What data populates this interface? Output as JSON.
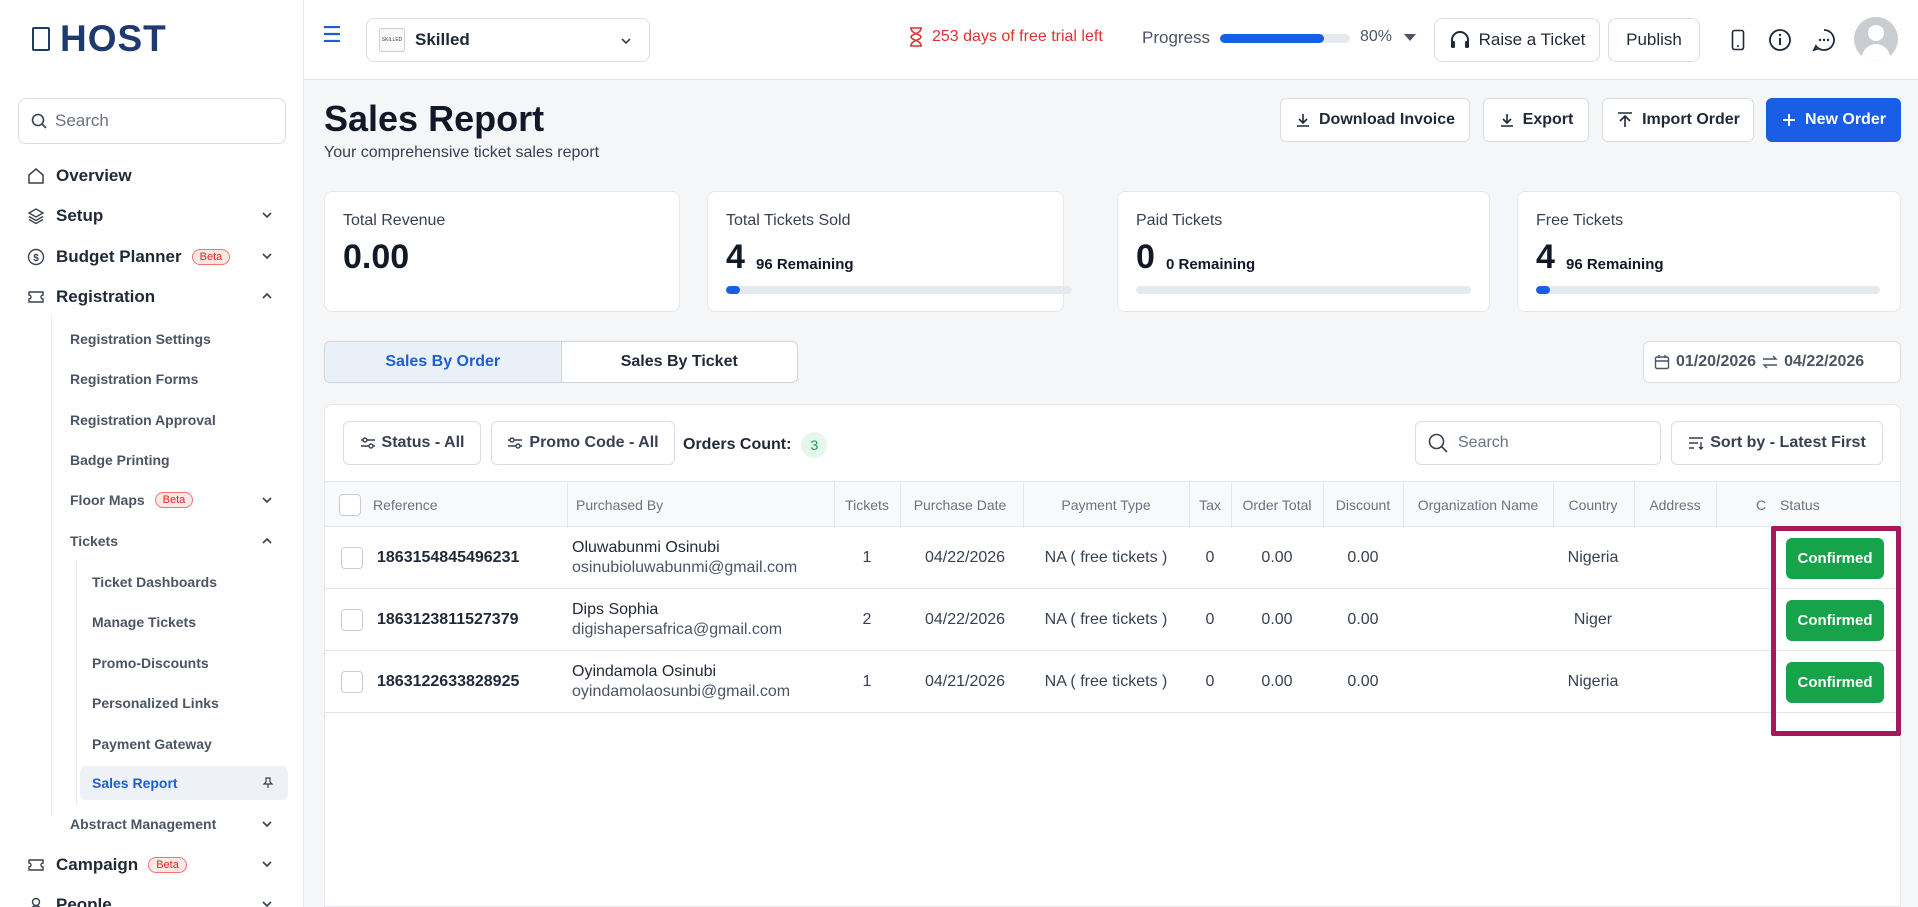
{
  "brand": {
    "name": "HOST"
  },
  "sidebar": {
    "search_placeholder": "Search",
    "items": [
      {
        "label": "Overview"
      },
      {
        "label": "Setup"
      },
      {
        "label": "Budget Planner",
        "badge": "Beta"
      },
      {
        "label": "Registration"
      },
      {
        "label": "Campaign",
        "badge": "Beta"
      },
      {
        "label": "People"
      }
    ],
    "registration_sub": [
      {
        "label": "Registration Settings"
      },
      {
        "label": "Registration Forms"
      },
      {
        "label": "Registration Approval"
      },
      {
        "label": "Badge Printing"
      },
      {
        "label": "Floor Maps",
        "badge": "Beta"
      },
      {
        "label": "Tickets"
      },
      {
        "label": "Abstract Management"
      }
    ],
    "tickets_sub": [
      {
        "label": "Ticket Dashboards"
      },
      {
        "label": "Manage Tickets"
      },
      {
        "label": "Promo-Discounts"
      },
      {
        "label": "Personalized Links"
      },
      {
        "label": "Payment Gateway"
      },
      {
        "label": "Sales Report"
      }
    ]
  },
  "topbar": {
    "event_name": "Skilled",
    "event_thumb_text": "SKILLED",
    "trial_text": "253 days of free trial left",
    "progress_label": "Progress",
    "progress_value": "80%",
    "progress_fraction": 0.8,
    "raise_ticket": "Raise a Ticket",
    "publish": "Publish"
  },
  "page": {
    "title": "Sales Report",
    "subtitle": "Your comprehensive ticket sales report",
    "actions": {
      "download_invoice": "Download Invoice",
      "export": "Export",
      "import_order": "Import Order",
      "new_order": "New Order"
    }
  },
  "stats": [
    {
      "label": "Total Revenue",
      "value": "0.00"
    },
    {
      "label": "Total Tickets Sold",
      "value": "4",
      "remaining": "96 Remaining",
      "fraction": 0.04
    },
    {
      "label": "Paid Tickets",
      "value": "0",
      "remaining": "0 Remaining",
      "fraction": 0
    },
    {
      "label": "Free Tickets",
      "value": "4",
      "remaining": "96 Remaining",
      "fraction": 0.04
    }
  ],
  "tabs": [
    {
      "label": "Sales By Order",
      "active": true
    },
    {
      "label": "Sales By Ticket",
      "active": false
    }
  ],
  "date_range": {
    "start": "01/20/2026",
    "end": "04/22/2026"
  },
  "filters": {
    "status": "Status - All",
    "promo": "Promo Code - All",
    "orders_count_label": "Orders Count:",
    "orders_count": "3",
    "search_placeholder": "Search",
    "sort": "Sort by - Latest First"
  },
  "table": {
    "columns": [
      "Reference",
      "Purchased By",
      "Tickets",
      "Purchase Date",
      "Payment Type",
      "Tax",
      "Order Total",
      "Discount",
      "Organization Name",
      "Country",
      "Address",
      "C",
      "Status"
    ],
    "rows": [
      {
        "reference": "1863154845496231",
        "name": "Oluwabunmi Osinubi",
        "email": "osinubioluwabunmi@gmail.com",
        "tickets": "1",
        "date": "04/22/2026",
        "payment": "NA ( free tickets )",
        "tax": "0",
        "total": "0.00",
        "discount": "0.00",
        "org": "",
        "country": "Nigeria",
        "address": "",
        "status": "Confirmed"
      },
      {
        "reference": "1863123811527379",
        "name": "Dips Sophia",
        "email": "digishapersafrica@gmail.com",
        "tickets": "2",
        "date": "04/22/2026",
        "payment": "NA ( free tickets )",
        "tax": "0",
        "total": "0.00",
        "discount": "0.00",
        "org": "",
        "country": "Niger",
        "address": "",
        "status": "Confirmed"
      },
      {
        "reference": "1863122633828925",
        "name": "Oyindamola Osinubi",
        "email": "oyindamolaosunbi@gmail.com",
        "tickets": "1",
        "date": "04/21/2026",
        "payment": "NA ( free tickets )",
        "tax": "0",
        "total": "0.00",
        "discount": "0.00",
        "org": "",
        "country": "Nigeria",
        "address": "",
        "status": "Confirmed"
      }
    ]
  },
  "colors": {
    "primary": "#1a5ee8",
    "confirmed": "#16a34a",
    "trial": "#e03131",
    "highlight": "#a3195b"
  }
}
